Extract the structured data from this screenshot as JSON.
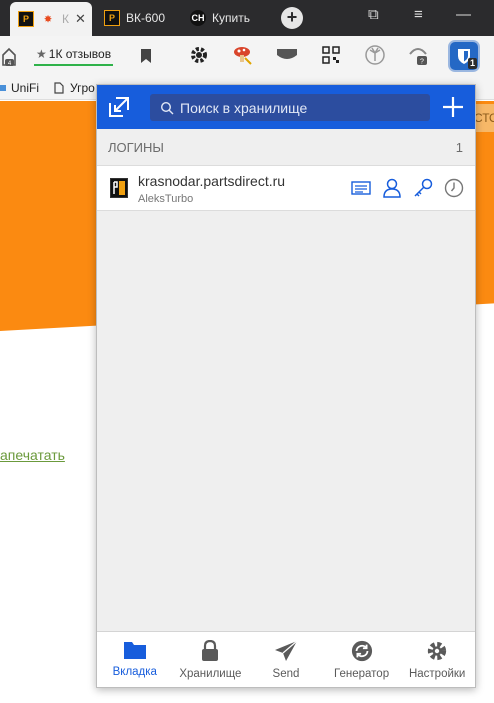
{
  "browser": {
    "tabs": [
      {
        "label": "К",
        "active": true
      },
      {
        "label": "ВК-600",
        "active": false
      },
      {
        "label": "Купить",
        "active": false
      }
    ],
    "reviews_label": "1К отзывов",
    "ext_badge": "1",
    "bookmarks": [
      "UniFi",
      "Угро"
    ]
  },
  "page": {
    "strip_text": "СТО",
    "link_text": "апечатать"
  },
  "popup": {
    "search_placeholder": "Поиск в хранилище",
    "section_title": "ЛОГИНЫ",
    "section_count": "1",
    "items": [
      {
        "title": "krasnodar.partsdirect.ru",
        "subtitle": "AleksTurbo"
      }
    ],
    "nav": [
      {
        "label": "Вкладка",
        "active": true
      },
      {
        "label": "Хранилище",
        "active": false
      },
      {
        "label": "Send",
        "active": false
      },
      {
        "label": "Генератор",
        "active": false
      },
      {
        "label": "Настройки",
        "active": false
      }
    ]
  },
  "colors": {
    "accent": "#175ddc",
    "page_orange": "#fb8a11",
    "tabbar": "#2b2b2d"
  }
}
